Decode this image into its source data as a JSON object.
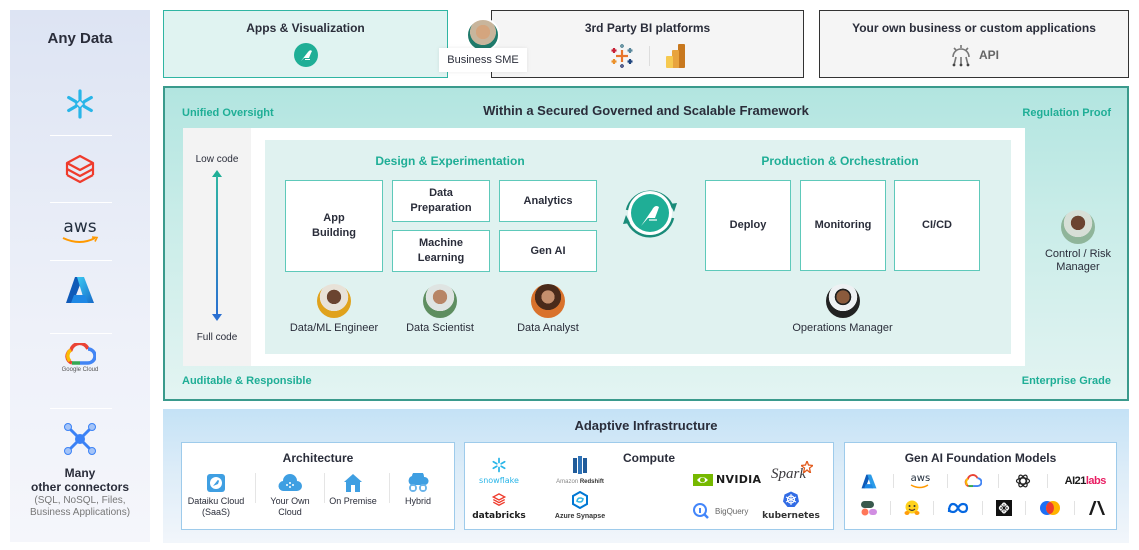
{
  "data_sources": {
    "title": "Any Data",
    "logos": [
      {
        "icon": "snowflake-icon",
        "label": ""
      },
      {
        "icon": "databricks-icon",
        "label": ""
      },
      {
        "icon": "aws-icon",
        "label": "aws"
      },
      {
        "icon": "azure-icon",
        "label": ""
      },
      {
        "icon": "google-cloud-icon",
        "label": "Google Cloud"
      },
      {
        "icon": "connectors-icon",
        "label": ""
      }
    ],
    "many_title_line1": "Many",
    "many_title_line2": "other connectors",
    "many_sub_line1": "(SQL, NoSQL, Files,",
    "many_sub_line2": "Business Applications)"
  },
  "top": {
    "apps": {
      "title": "Apps & Visualization",
      "icon": "dataiku-bird-icon"
    },
    "sme": {
      "label": "Business SME"
    },
    "bi": {
      "title": "3rd Party BI platforms",
      "icons": [
        "tableau-icon",
        "power-bi-icon"
      ]
    },
    "own": {
      "title": "Your own business or custom applications",
      "api_label": "API",
      "icon": "api-gear-icon"
    }
  },
  "framework": {
    "title": "Within a Secured  Governed and Scalable Framework",
    "corners": {
      "top_left": "Unified Oversight",
      "top_right": "Regulation Proof",
      "bottom_left": "Auditable & Responsible",
      "bottom_right": "Enterprise Grade"
    },
    "code_scale": {
      "top": "Low code",
      "bottom": "Full code"
    },
    "design": {
      "title": "Design & Experimentation",
      "capabilities": [
        {
          "label_line1": "App",
          "label_line2": "Building"
        },
        {
          "label_line1": "Data",
          "label_line2": "Preparation"
        },
        {
          "label_line1": "Analytics",
          "label_line2": ""
        },
        {
          "label_line1": "Machine",
          "label_line2": "Learning"
        },
        {
          "label_line1": "Gen AI",
          "label_line2": ""
        }
      ],
      "personas": [
        "Data/ML Engineer",
        "Data Scientist",
        "Data Analyst"
      ]
    },
    "production": {
      "title": "Production & Orchestration",
      "capabilities": [
        "Deploy",
        "Monitoring",
        "CI/CD"
      ],
      "persona": "Operations Manager"
    },
    "risk_persona": {
      "line1": "Control / Risk",
      "line2": "Manager"
    }
  },
  "infrastructure": {
    "title": "Adaptive Infrastructure",
    "architecture": {
      "title": "Architecture",
      "items": [
        {
          "line1": "Dataiku Cloud",
          "line2": "(SaaS)",
          "icon": "dataiku-cloud-icon"
        },
        {
          "line1": "Your Own",
          "line2": "Cloud",
          "icon": "cloud-icon"
        },
        {
          "line1": "On Premise",
          "line2": "",
          "icon": "house-icon"
        },
        {
          "line1": "Hybrid",
          "line2": "",
          "icon": "hybrid-cloud-icon"
        }
      ]
    },
    "compute": {
      "title": "Compute",
      "logos": {
        "snowflake": "snowflake",
        "redshift_prefix": "Amazon",
        "redshift": "Redshift",
        "databricks": "databricks",
        "synapse": "Azure Synapse",
        "nvidia": "NVIDIA",
        "spark": "Spark",
        "bigquery": "BigQuery",
        "kubernetes": "kubernetes"
      }
    },
    "genai": {
      "title": "Gen AI Foundation Models",
      "row1": [
        "azure-icon",
        "aws-icon",
        "google-cloud-icon",
        "openai-icon",
        "ai21-labs-icon"
      ],
      "row2": [
        "cohere-icon",
        "hugging-face-icon",
        "meta-icon",
        "mistral-icon",
        "gemini-icon",
        "anthropic-icon"
      ],
      "aws_text": "aws",
      "ai21_text": "AI21",
      "ai21_labs": "labs"
    }
  },
  "colors": {
    "teal_accent": "#1fae96",
    "teal_border": "#3a9a8c",
    "capability_border": "#5ec9ba",
    "infra_border": "#9ecbeb"
  }
}
